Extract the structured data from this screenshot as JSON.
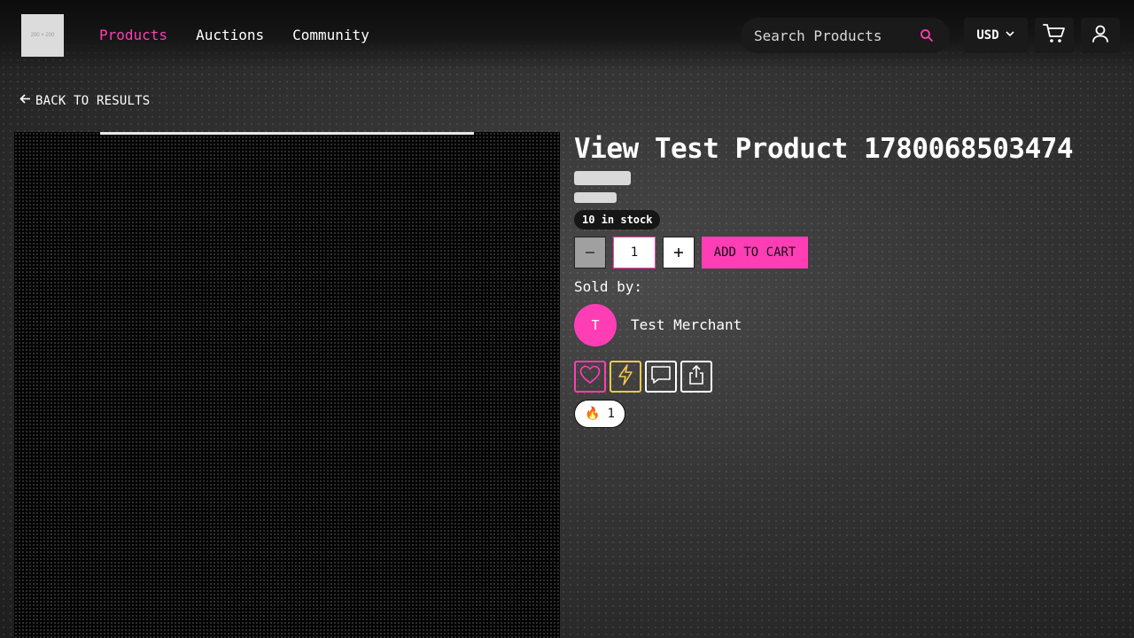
{
  "header": {
    "logo_text": "200 × 200",
    "nav": [
      {
        "label": "Products",
        "active": true
      },
      {
        "label": "Auctions",
        "active": false
      },
      {
        "label": "Community",
        "active": false
      }
    ],
    "search": {
      "placeholder": "Search Products"
    },
    "currency": "USD",
    "icons": [
      "cart-icon",
      "user-icon"
    ]
  },
  "back_label": "BACK TO RESULTS",
  "product": {
    "title": "View Test Product 1780068503474",
    "stock": "10 in stock",
    "quantity": "1",
    "add_to_cart": "ADD TO CART",
    "sold_by_label": "Sold by:",
    "merchant_initial": "T",
    "merchant_name": "Test Merchant",
    "actions": [
      "heart-icon",
      "lightning-icon",
      "message-icon",
      "share-icon"
    ],
    "reaction": {
      "emoji": "🔥",
      "count": "1"
    }
  },
  "colors": {
    "accent": "#ff3eb5",
    "boost": "#f2c94c",
    "header_bg": "#111111"
  }
}
